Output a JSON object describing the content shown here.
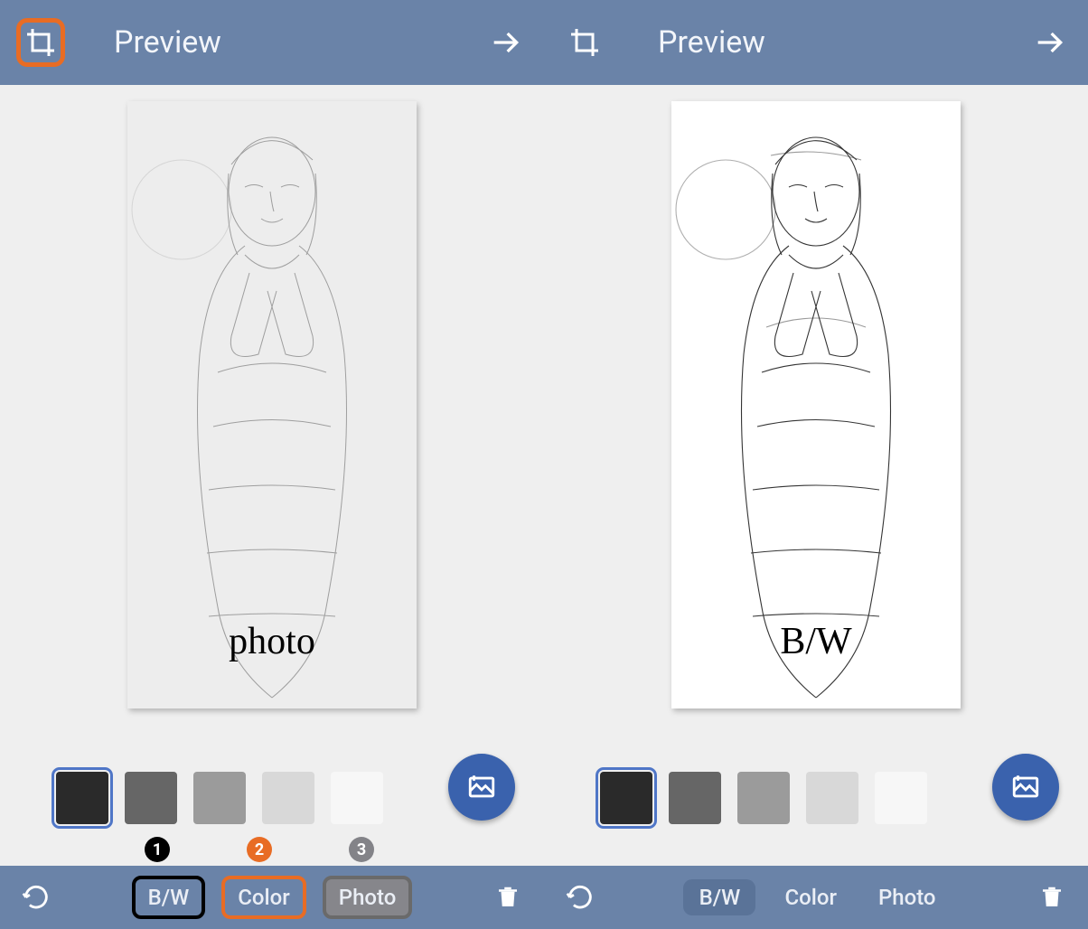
{
  "panes": [
    {
      "title": "Preview",
      "crop_highlighted": true,
      "preview_mode": "photo",
      "preview_label": "photo",
      "swatches": [
        {
          "color": "#2a2a2a",
          "selected": true
        },
        {
          "color": "#666666",
          "selected": false
        },
        {
          "color": "#9b9b9b",
          "selected": false
        },
        {
          "color": "#d8d8d8",
          "selected": false
        },
        {
          "color": "#f7f7f7",
          "selected": false
        }
      ],
      "badges": [
        {
          "num": "1",
          "bg": "#000000"
        },
        {
          "num": "2",
          "bg": "#e86c24"
        },
        {
          "num": "3",
          "bg": "#838388"
        }
      ],
      "tabs": [
        {
          "label": "B/W",
          "hl": "hl-black"
        },
        {
          "label": "Color",
          "hl": "hl-orange"
        },
        {
          "label": "Photo",
          "hl": "hl-grey"
        }
      ]
    },
    {
      "title": "Preview",
      "crop_highlighted": false,
      "preview_mode": "bw",
      "preview_label": "B/W",
      "swatches": [
        {
          "color": "#2a2a2a",
          "selected": true
        },
        {
          "color": "#666666",
          "selected": false
        },
        {
          "color": "#9b9b9b",
          "selected": false
        },
        {
          "color": "#d8d8d8",
          "selected": false
        },
        {
          "color": "#f7f7f7",
          "selected": false
        }
      ],
      "badges": [],
      "tabs": [
        {
          "label": "B/W",
          "active": true
        },
        {
          "label": "Color",
          "active": false
        },
        {
          "label": "Photo",
          "active": false
        }
      ]
    }
  ],
  "icons": {
    "crop": "crop-icon",
    "arrow": "arrow-right-icon",
    "rotate": "rotate-icon",
    "trash": "trash-icon",
    "add_image": "add-image-icon"
  }
}
